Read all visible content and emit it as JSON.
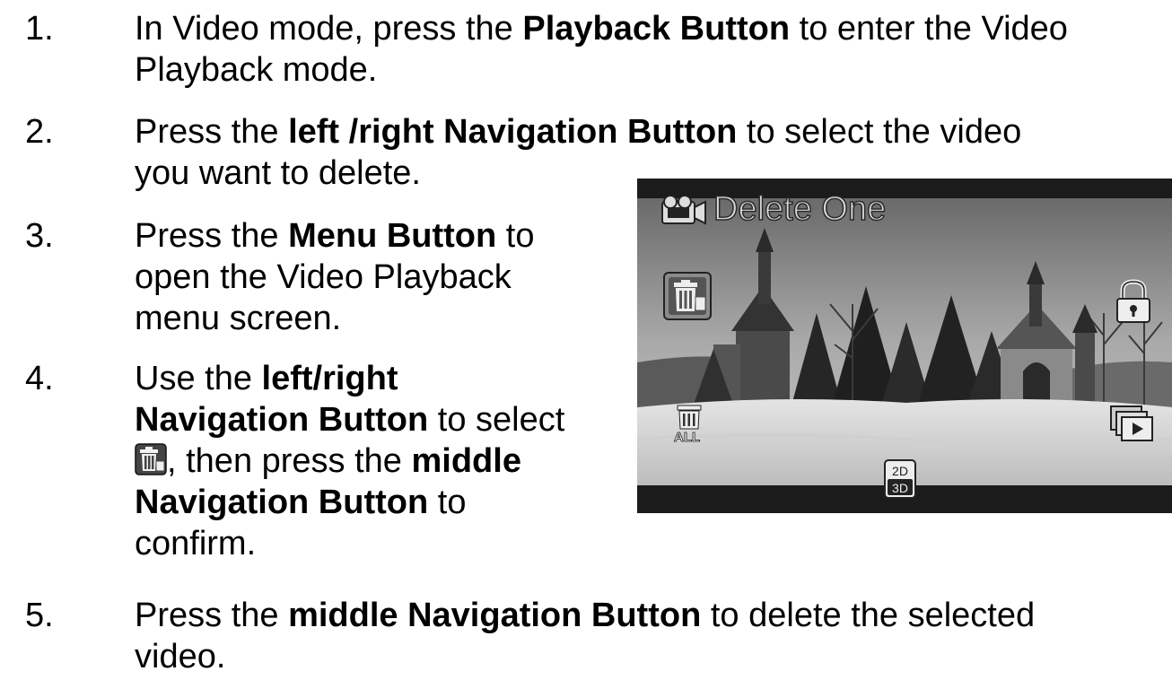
{
  "steps": [
    {
      "number": "1.",
      "parts": [
        {
          "t": "In Video mode, press the ",
          "b": false
        },
        {
          "t": "Playback Button",
          "b": true
        },
        {
          "t": " to enter the Video",
          "b": false
        },
        {
          "t": "Playback mode.",
          "b": false,
          "br": true
        }
      ]
    },
    {
      "number": "2.",
      "parts": [
        {
          "t": "Press the ",
          "b": false
        },
        {
          "t": "left /right Navigation Button",
          "b": true
        },
        {
          "t": " to select the video",
          "b": false
        },
        {
          "t": "you want to delete.",
          "b": false,
          "br": true
        }
      ]
    },
    {
      "number": "3.",
      "parts": [
        {
          "t": "Press the ",
          "b": false
        },
        {
          "t": "Menu Button",
          "b": true
        },
        {
          "t": " to",
          "b": false
        },
        {
          "t": "open the Video Playback",
          "b": false,
          "br": true
        },
        {
          "t": "menu screen.",
          "b": false,
          "br": true
        }
      ]
    },
    {
      "number": "4.",
      "parts": [
        {
          "t": "Use the ",
          "b": false
        },
        {
          "t": "left/right",
          "b": true
        },
        {
          "t": "Navigation Button",
          "b": true,
          "br": true
        },
        {
          "t": " to select",
          "b": false
        },
        {
          "icon": "delete-one-icon",
          "br": true
        },
        {
          "t": ", then press the ",
          "b": false
        },
        {
          "t": "middle",
          "b": true
        },
        {
          "t": "Navigation Button",
          "b": true,
          "br": true
        },
        {
          "t": " to",
          "b": false
        },
        {
          "t": "confirm.",
          "b": false,
          "br": true
        }
      ]
    },
    {
      "number": "5.",
      "parts": [
        {
          "t": "Press the ",
          "b": false
        },
        {
          "t": "middle Navigation Button",
          "b": true
        },
        {
          "t": " to delete the selected",
          "b": false
        },
        {
          "t": "video.",
          "b": false,
          "br": true
        }
      ]
    }
  ],
  "screen": {
    "title": "Delete One",
    "mode_icon": "video-camera-icon",
    "icons": [
      "delete-one-icon",
      "protect-lock-icon",
      "delete-all-icon",
      "slideshow-icon",
      "2d-3d-icon"
    ],
    "delete_all_label": "ALL",
    "badge_2d": "2D",
    "badge_3d": "3D"
  }
}
